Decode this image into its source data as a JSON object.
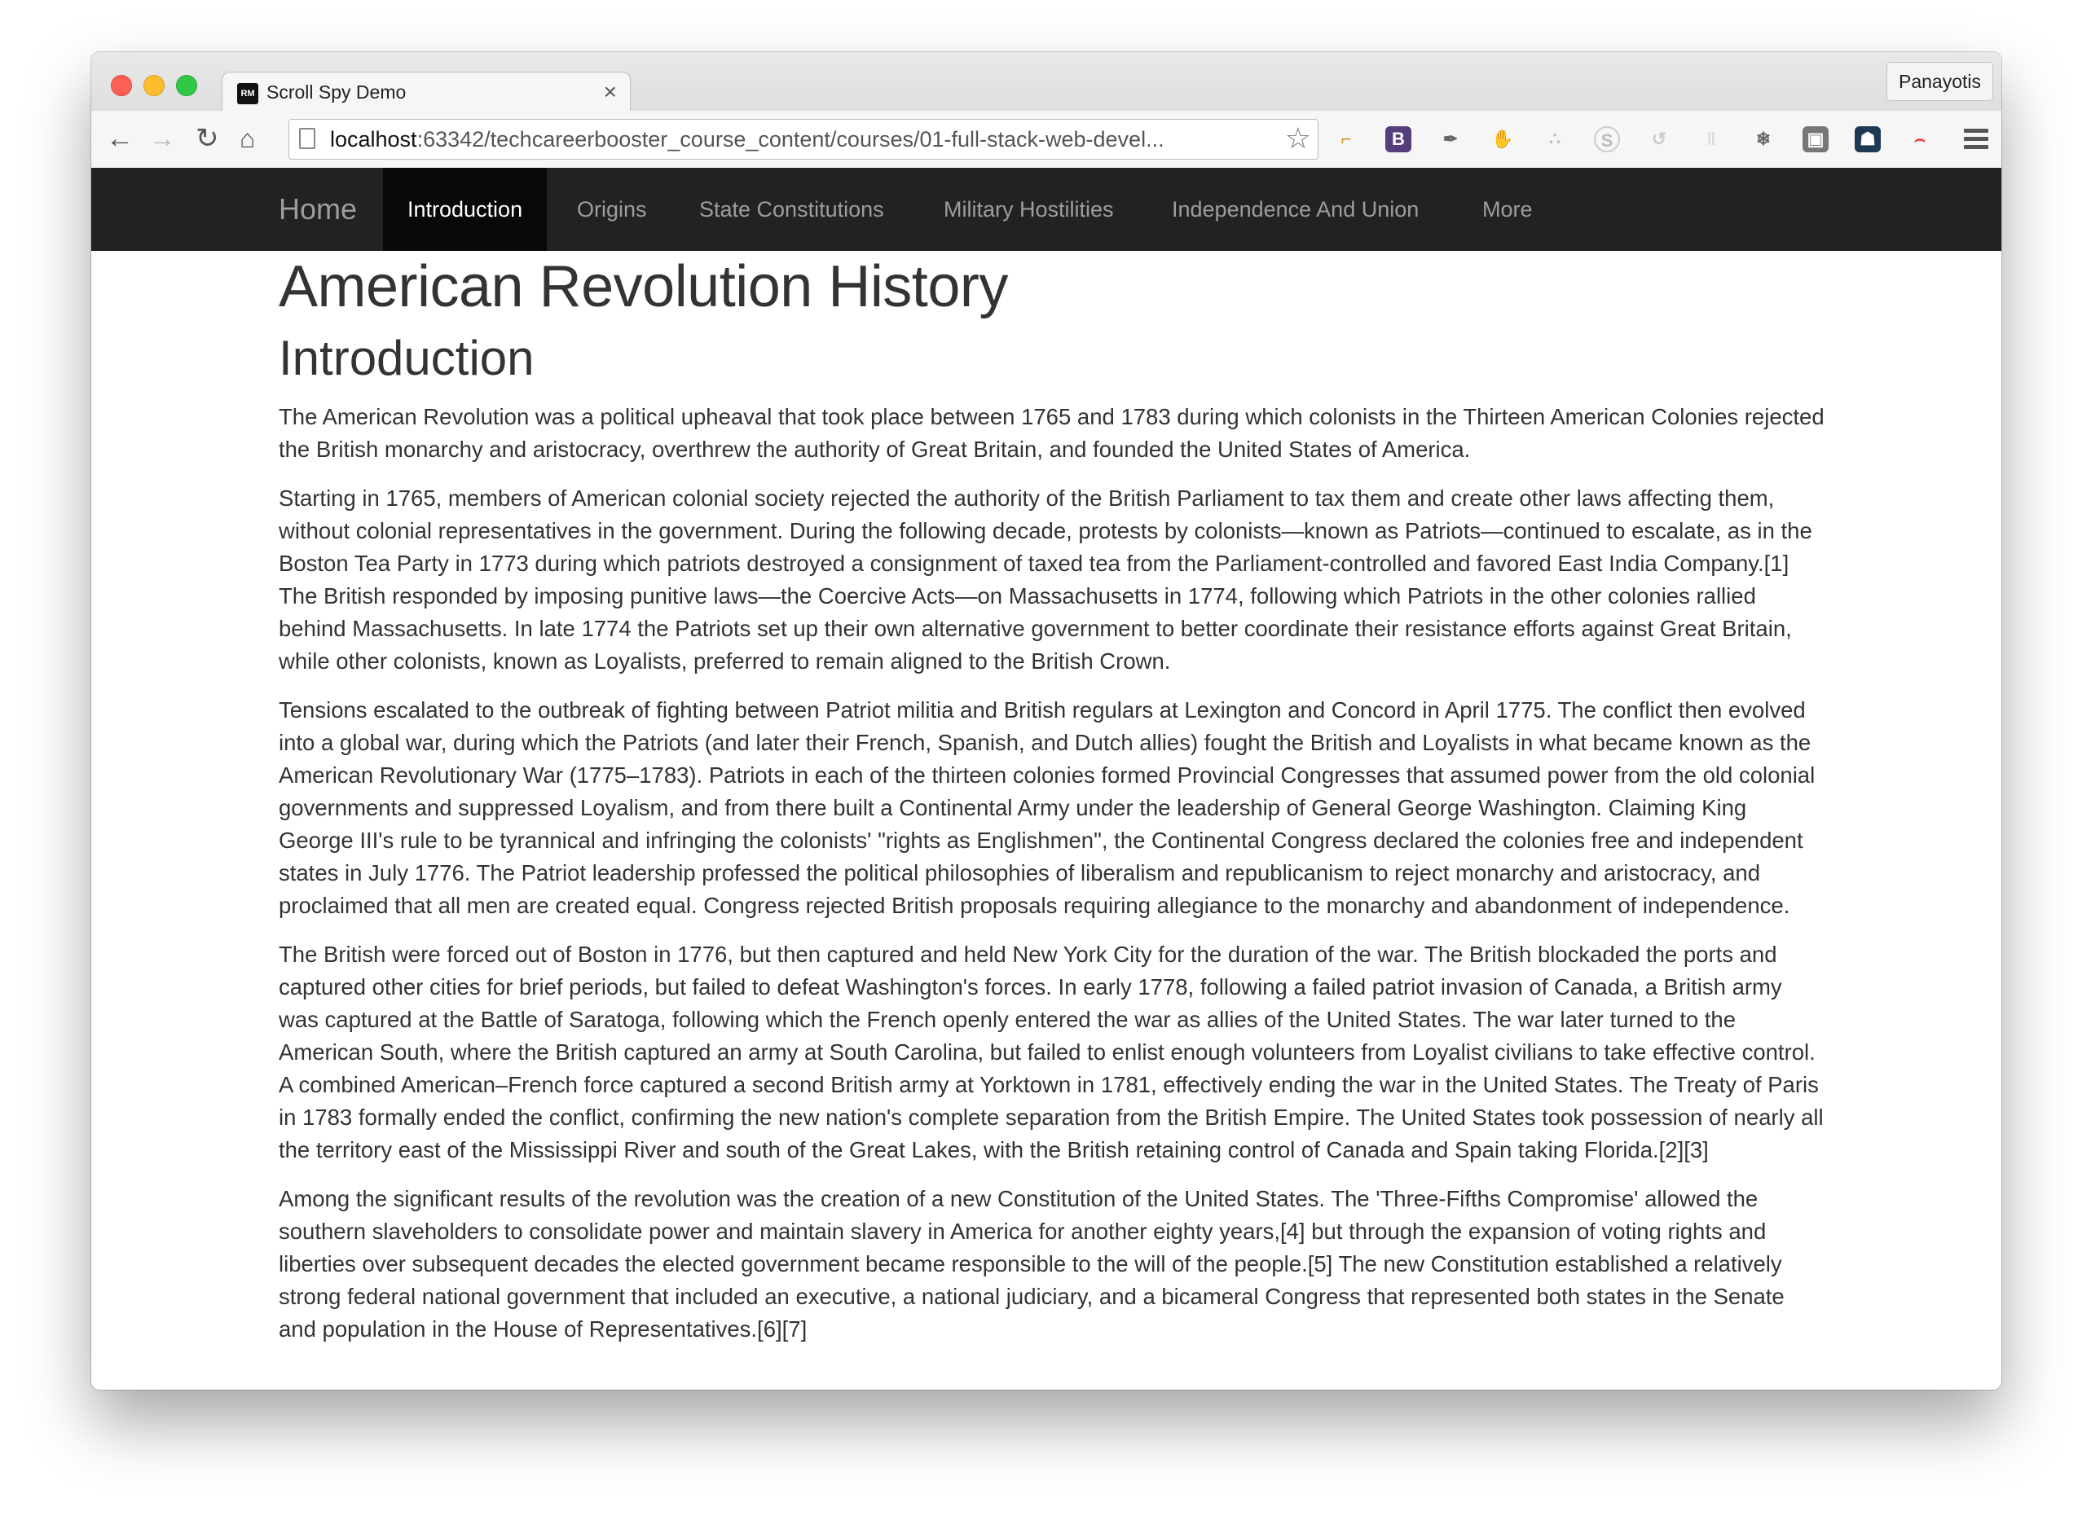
{
  "browser": {
    "tab_favicon": "RM",
    "tab_title": "Scroll Spy Demo",
    "tab_close": "×",
    "profile_name": "Panayotis",
    "url_host": "localhost",
    "url_rest": ":63342/techcareerbooster_course_content/courses/01-full-stack-web-devel...",
    "extensions": [
      "bookmark-pin-icon",
      "bootstrap-icon",
      "eyedropper-icon",
      "evernote-icon",
      "network-icon",
      "skype-icon",
      "sync-icon",
      "pause-icon",
      "snowflake-icon",
      "shield-icon",
      "ghostery-icon",
      "rainbow-icon"
    ]
  },
  "navbar": {
    "brand": "Home",
    "items": [
      "Introduction",
      "Origins",
      "State Constitutions",
      "Military Hostilities",
      "Independence And Union",
      "More"
    ],
    "active_index": 0
  },
  "content": {
    "title": "American Revolution History",
    "section_title": "Introduction",
    "paragraphs": [
      "The American Revolution was a political upheaval that took place between 1765 and 1783 during which colonists in the Thirteen American Colonies rejected the British monarchy and aristocracy, overthrew the authority of Great Britain, and founded the United States of America.",
      "Starting in 1765, members of American colonial society rejected the authority of the British Parliament to tax them and create other laws affecting them, without colonial representatives in the government. During the following decade, protests by colonists—known as Patriots—continued to escalate, as in the Boston Tea Party in 1773 during which patriots destroyed a consignment of taxed tea from the Parliament-controlled and favored East India Company.[1] The British responded by imposing punitive laws—the Coercive Acts—on Massachusetts in 1774, following which Patriots in the other colonies rallied behind Massachusetts. In late 1774 the Patriots set up their own alternative government to better coordinate their resistance efforts against Great Britain, while other colonists, known as Loyalists, preferred to remain aligned to the British Crown.",
      "Tensions escalated to the outbreak of fighting between Patriot militia and British regulars at Lexington and Concord in April 1775. The conflict then evolved into a global war, during which the Patriots (and later their French, Spanish, and Dutch allies) fought the British and Loyalists in what became known as the American Revolutionary War (1775–1783). Patriots in each of the thirteen colonies formed Provincial Congresses that assumed power from the old colonial governments and suppressed Loyalism, and from there built a Continental Army under the leadership of General George Washington. Claiming King George III's rule to be tyrannical and infringing the colonists' \"rights as Englishmen\", the Continental Congress declared the colonies free and independent states in July 1776. The Patriot leadership professed the political philosophies of liberalism and republicanism to reject monarchy and aristocracy, and proclaimed that all men are created equal. Congress rejected British proposals requiring allegiance to the monarchy and abandonment of independence.",
      "The British were forced out of Boston in 1776, but then captured and held New York City for the duration of the war. The British blockaded the ports and captured other cities for brief periods, but failed to defeat Washington's forces. In early 1778, following a failed patriot invasion of Canada, a British army was captured at the Battle of Saratoga, following which the French openly entered the war as allies of the United States. The war later turned to the American South, where the British captured an army at South Carolina, but failed to enlist enough volunteers from Loyalist civilians to take effective control. A combined American–French force captured a second British army at Yorktown in 1781, effectively ending the war in the United States. The Treaty of Paris in 1783 formally ended the conflict, confirming the new nation's complete separation from the British Empire. The United States took possession of nearly all the territory east of the Mississippi River and south of the Great Lakes, with the British retaining control of Canada and Spain taking Florida.[2][3]",
      "Among the significant results of the revolution was the creation of a new Constitution of the United States. The 'Three-Fifths Compromise' allowed the southern slaveholders to consolidate power and maintain slavery in America for another eighty years,[4] but through the expansion of voting rights and liberties over subsequent decades the elected government became responsible to the will of the people.[5] The new Constitution established a relatively strong federal national government that included an executive, a national judiciary, and a bicameral Congress that represented both states in the Senate and population in the House of Representatives.[6][7]"
    ]
  },
  "colors": {
    "navbar_bg": "#222222",
    "navbar_active_bg": "#080808",
    "navbar_text": "#9d9d9d",
    "body_text": "#333333"
  }
}
